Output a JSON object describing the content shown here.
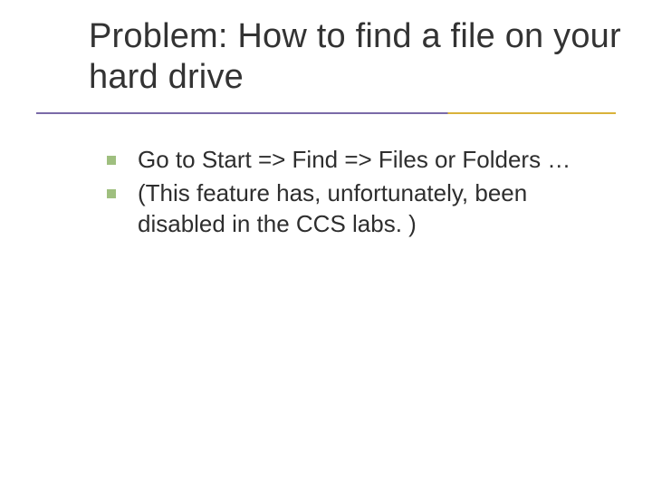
{
  "slide": {
    "title": "Problem: How to find a file on your hard drive",
    "bullets": [
      "Go to Start => Find => Files or Folders …",
      "(This feature has, unfortunately, been disabled in the CCS labs. )"
    ]
  }
}
